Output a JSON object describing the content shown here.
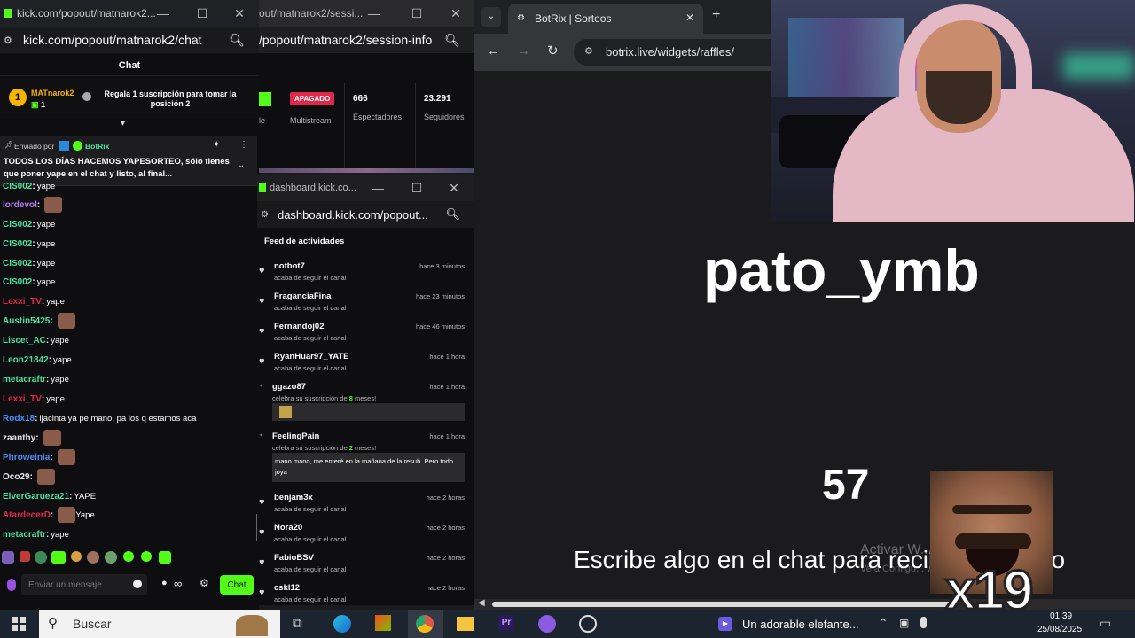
{
  "chat_window": {
    "title": "kick.com/popout/matnarok2...",
    "url": "kick.com/popout/matnarok2/chat",
    "header": "Chat",
    "pinned_top": {
      "user": "MATnarok2",
      "count": "1",
      "message": "Regala 1 suscripción para tomar la posición 2"
    },
    "pinned_msg": {
      "sent_by_label": "Enviado por",
      "sender": "BotRix",
      "text": "TODOS LOS DÍAS HACEMOS YAPESORTEO, sólo tienes que poner yape en el chat y listo, al final..."
    },
    "messages": [
      {
        "user": "CIS002",
        "text": "yape",
        "color": "#4ee0a0",
        "emote": false
      },
      {
        "user": "lordevol",
        "text": "",
        "color": "#b57cf5",
        "emote": true
      },
      {
        "user": "CIS002",
        "text": "yape",
        "color": "#4ee0a0",
        "emote": false
      },
      {
        "user": "CIS002",
        "text": "yape",
        "color": "#4ee0a0",
        "emote": false
      },
      {
        "user": "CIS002",
        "text": "yape",
        "color": "#4ee0a0",
        "emote": false
      },
      {
        "user": "CIS002",
        "text": "yape",
        "color": "#4ee0a0",
        "emote": false
      },
      {
        "user": "Lexxi_TV",
        "text": "yape",
        "color": "#e0284a",
        "emote": false
      },
      {
        "user": "Austin5425",
        "text": "",
        "color": "#4ee0a0",
        "emote": true
      },
      {
        "user": "Liscet_AC",
        "text": "yape",
        "color": "#4ee0a0",
        "emote": false
      },
      {
        "user": "Leon21842",
        "text": "yape",
        "color": "#4ee0a0",
        "emote": false
      },
      {
        "user": "metacraftr",
        "text": "yape",
        "color": "#4ee0a0",
        "emote": false
      },
      {
        "user": "Lexxi_TV",
        "text": "yape",
        "color": "#e0284a",
        "emote": false
      },
      {
        "user": "Rodx18",
        "text": "ljacinta ya pe mano, pa los q estamos aca",
        "color": "#4c8cf5",
        "emote": false
      },
      {
        "user": "zaanthy",
        "text": "",
        "color": "#e6e6e6",
        "emote": true
      },
      {
        "user": "Phroweinia",
        "text": "",
        "color": "#4c8cf5",
        "emote": true
      },
      {
        "user": "Oco29",
        "text": "",
        "color": "#e6e6e6",
        "emote": true
      },
      {
        "user": "ElverGarueza21",
        "text": "YAPE",
        "color": "#4ee0a0",
        "emote": false
      },
      {
        "user": "AtardecerD",
        "text": "Yape",
        "color": "#e0284a",
        "emote": true
      },
      {
        "user": "metacraftr",
        "text": "yape",
        "color": "#4ee0a0",
        "emote": false
      }
    ],
    "input_placeholder": "Enviar un mensaje",
    "send_label": "Chat",
    "infinity_label": "∞"
  },
  "session_window": {
    "url": "/popout/matnarok2/session-info",
    "title": "out/matnarok2/sessi...",
    "status_badge": "APAGADO",
    "multistream_label": "Multistream",
    "viewers_value": "666",
    "viewers_label": "Espectadores",
    "followers_value": "23.291",
    "followers_label": "Seguidores",
    "cut_label": "le"
  },
  "dashboard_window": {
    "title": "dashboard.kick.co...",
    "url": "dashboard.kick.com/popout...",
    "feed_title": "Feed de actividades",
    "items": [
      {
        "name": "notbot7",
        "time": "hace 3 minutos",
        "sub": "acaba de seguir el canal"
      },
      {
        "name": "FraganciaFina",
        "time": "hace 23 minutos",
        "sub": "acaba de seguir el canal"
      },
      {
        "name": "Fernandoj02",
        "time": "hace 46 minutos",
        "sub": "acaba de seguir el canal"
      },
      {
        "name": "RyanHuar97_YATE",
        "time": "hace 1 hora",
        "sub": "acaba de seguir el canal"
      }
    ],
    "sub1": {
      "name": "ggazo87",
      "time": "hace 1 hora",
      "sub_prefix": "celebra su suscripción de",
      "months": "8",
      "sub_suffix": "meses!"
    },
    "sub2": {
      "name": "FeelingPain",
      "time": "hace 1 hora",
      "sub_prefix": "celebra su suscripción de",
      "months": "2",
      "sub_suffix": "meses!",
      "message": "mano mano, me enteré en la mañana de la resub. Pero todo joya"
    },
    "items2": [
      {
        "name": "benjam3x",
        "time": "hace 2 horas",
        "sub": "acaba de seguir el canal"
      },
      {
        "name": "Nora20",
        "time": "hace 2 horas",
        "sub": "acaba de seguir el canal"
      },
      {
        "name": "FabioBSV",
        "time": "hace 2 horas",
        "sub": "acaba de seguir el canal"
      },
      {
        "name": "cskl12",
        "time": "hace 2 horas",
        "sub": "acaba de seguir el canal"
      }
    ]
  },
  "browser": {
    "tab_title": "BotRix | Sorteos",
    "url": "botrix.live/widgets/raffles/",
    "winner": "pato_ymb",
    "counter": "57",
    "instruction": "Escribe algo en el chat para recibir el premio",
    "watermark": "Activar W...",
    "watermark2": "Ve a Configu... windows."
  },
  "overlay": {
    "multiplier": "x19"
  },
  "taskbar": {
    "search_placeholder": "Buscar",
    "media_title": "Un adorable elefante...",
    "time": "01:39",
    "date": "25/08/2025"
  }
}
